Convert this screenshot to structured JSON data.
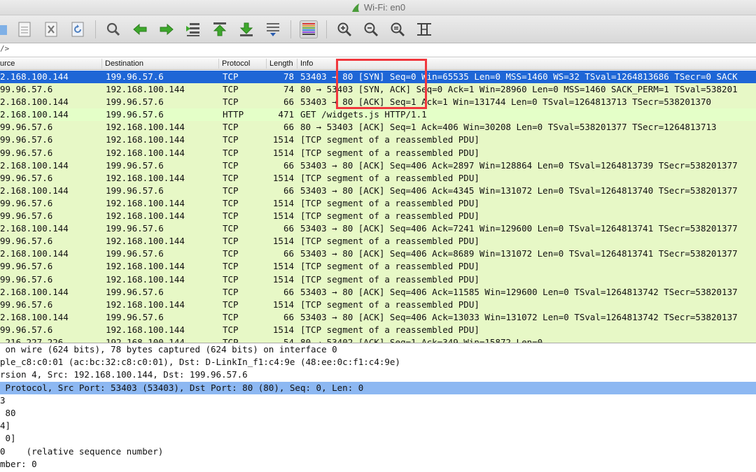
{
  "window": {
    "title": "Wi-Fi: en0"
  },
  "toolbar": {
    "icons": [
      "file-icon",
      "close-file-icon",
      "reload-icon",
      "find-icon",
      "back-icon",
      "forward-icon",
      "go-to-packet-icon",
      "first-packet-icon",
      "last-packet-icon",
      "autoscroll-icon",
      "colorize-icon",
      "zoom-in-icon",
      "zoom-out-icon",
      "normal-size-icon",
      "resize-columns-icon"
    ]
  },
  "filter": {
    "value": "/>"
  },
  "columns": {
    "source": "urce",
    "destination": "Destination",
    "protocol": "Protocol",
    "length": "Length",
    "info": "Info"
  },
  "packets": [
    {
      "src": "2.168.100.144",
      "dst": "199.96.57.6",
      "proto": "TCP",
      "len": "78",
      "info": "53403 → 80 [SYN] Seq=0 Win=65535 Len=0 MSS=1460 WS=32 TSval=1264813686 TSecr=0 SACK"
    },
    {
      "src": "99.96.57.6",
      "dst": "192.168.100.144",
      "proto": "TCP",
      "len": "74",
      "info": "80 → 53403 [SYN, ACK] Seq=0 Ack=1 Win=28960 Len=0 MSS=1460 SACK_PERM=1 TSval=538201"
    },
    {
      "src": "2.168.100.144",
      "dst": "199.96.57.6",
      "proto": "TCP",
      "len": "66",
      "info": "53403 → 80 [ACK] Seq=1 Ack=1 Win=131744 Len=0 TSval=1264813713 TSecr=538201370"
    },
    {
      "src": "2.168.100.144",
      "dst": "199.96.57.6",
      "proto": "HTTP",
      "len": "471",
      "info": "GET /widgets.js HTTP/1.1"
    },
    {
      "src": "99.96.57.6",
      "dst": "192.168.100.144",
      "proto": "TCP",
      "len": "66",
      "info": "80 → 53403 [ACK] Seq=1 Ack=406 Win=30208 Len=0 TSval=538201377 TSecr=1264813713"
    },
    {
      "src": "99.96.57.6",
      "dst": "192.168.100.144",
      "proto": "TCP",
      "len": "1514",
      "info": "[TCP segment of a reassembled PDU]"
    },
    {
      "src": "99.96.57.6",
      "dst": "192.168.100.144",
      "proto": "TCP",
      "len": "1514",
      "info": "[TCP segment of a reassembled PDU]"
    },
    {
      "src": "2.168.100.144",
      "dst": "199.96.57.6",
      "proto": "TCP",
      "len": "66",
      "info": "53403 → 80 [ACK] Seq=406 Ack=2897 Win=128864 Len=0 TSval=1264813739 TSecr=538201377"
    },
    {
      "src": "99.96.57.6",
      "dst": "192.168.100.144",
      "proto": "TCP",
      "len": "1514",
      "info": "[TCP segment of a reassembled PDU]"
    },
    {
      "src": "2.168.100.144",
      "dst": "199.96.57.6",
      "proto": "TCP",
      "len": "66",
      "info": "53403 → 80 [ACK] Seq=406 Ack=4345 Win=131072 Len=0 TSval=1264813740 TSecr=538201377"
    },
    {
      "src": "99.96.57.6",
      "dst": "192.168.100.144",
      "proto": "TCP",
      "len": "1514",
      "info": "[TCP segment of a reassembled PDU]"
    },
    {
      "src": "99.96.57.6",
      "dst": "192.168.100.144",
      "proto": "TCP",
      "len": "1514",
      "info": "[TCP segment of a reassembled PDU]"
    },
    {
      "src": "2.168.100.144",
      "dst": "199.96.57.6",
      "proto": "TCP",
      "len": "66",
      "info": "53403 → 80 [ACK] Seq=406 Ack=7241 Win=129600 Len=0 TSval=1264813741 TSecr=538201377"
    },
    {
      "src": "99.96.57.6",
      "dst": "192.168.100.144",
      "proto": "TCP",
      "len": "1514",
      "info": "[TCP segment of a reassembled PDU]"
    },
    {
      "src": "2.168.100.144",
      "dst": "199.96.57.6",
      "proto": "TCP",
      "len": "66",
      "info": "53403 → 80 [ACK] Seq=406 Ack=8689 Win=131072 Len=0 TSval=1264813741 TSecr=538201377"
    },
    {
      "src": "99.96.57.6",
      "dst": "192.168.100.144",
      "proto": "TCP",
      "len": "1514",
      "info": "[TCP segment of a reassembled PDU]"
    },
    {
      "src": "99.96.57.6",
      "dst": "192.168.100.144",
      "proto": "TCP",
      "len": "1514",
      "info": "[TCP segment of a reassembled PDU]"
    },
    {
      "src": "2.168.100.144",
      "dst": "199.96.57.6",
      "proto": "TCP",
      "len": "66",
      "info": "53403 → 80 [ACK] Seq=406 Ack=11585 Win=129600 Len=0 TSval=1264813742 TSecr=53820137"
    },
    {
      "src": "99.96.57.6",
      "dst": "192.168.100.144",
      "proto": "TCP",
      "len": "1514",
      "info": "[TCP segment of a reassembled PDU]"
    },
    {
      "src": "2.168.100.144",
      "dst": "199.96.57.6",
      "proto": "TCP",
      "len": "66",
      "info": "53403 → 80 [ACK] Seq=406 Ack=13033 Win=131072 Len=0 TSval=1264813742 TSecr=53820137"
    },
    {
      "src": "99.96.57.6",
      "dst": "192.168.100.144",
      "proto": "TCP",
      "len": "1514",
      "info": "[TCP segment of a reassembled PDU]"
    },
    {
      "src": ".216.227.226",
      "dst": "192.168.100.144",
      "proto": "TCP",
      "len": "54",
      "info": "80 → 53402 [ACK] Seq=1 Ack=349 Win=15872 Len=0"
    }
  ],
  "details": [
    " on wire (624 bits), 78 bytes captured (624 bits) on interface 0",
    "ple_c8:c0:01 (ac:bc:32:c8:c0:01), Dst: D-LinkIn_f1:c4:9e (48:ee:0c:f1:c4:9e)",
    "rsion 4, Src: 192.168.100.144, Dst: 199.96.57.6",
    " Protocol, Src Port: 53403 (53403), Dst Port: 80 (80), Seq: 0, Len: 0",
    "3",
    " 80",
    "4]",
    " 0]",
    "0    (relative sequence number)",
    "mber: 0"
  ],
  "colors": {
    "tcp_row": "#e7f8c6",
    "selected_row": "#1e66d6",
    "selected_detail": "#8db8f2",
    "annotation": "#f0383e"
  }
}
